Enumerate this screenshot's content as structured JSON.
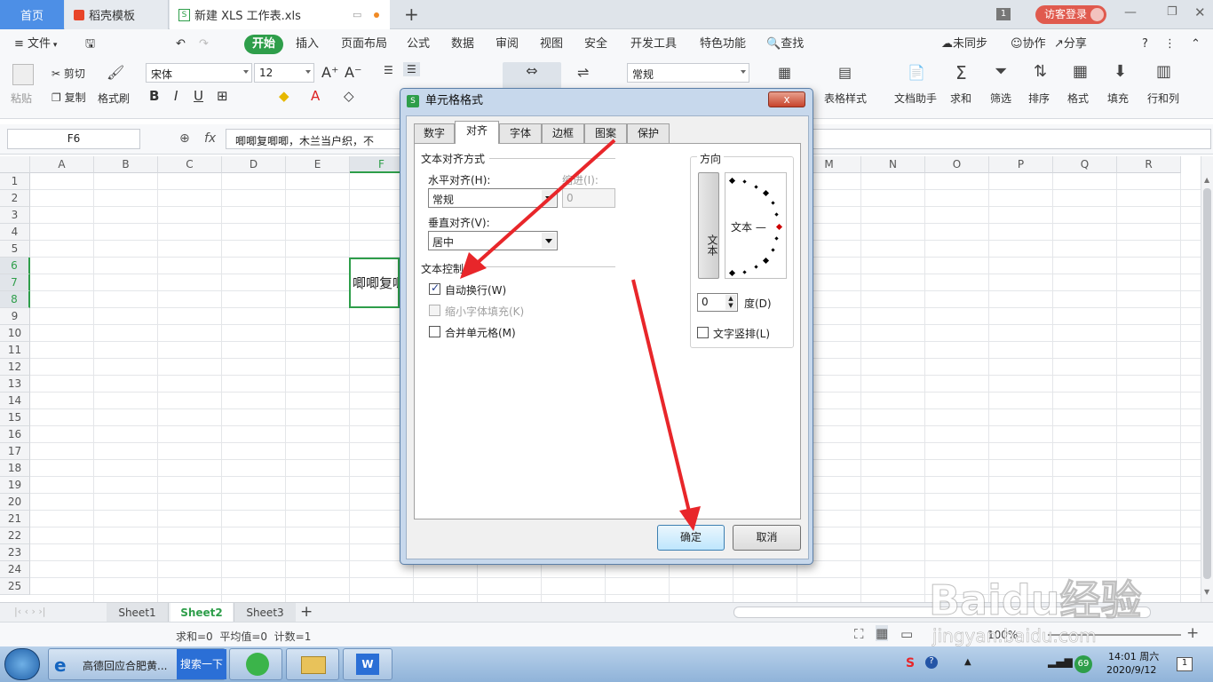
{
  "tabs": {
    "home": "首页",
    "template": "稻壳模板",
    "file": "新建 XLS 工作表.xls",
    "add": "+"
  },
  "titlebar": {
    "badge": "1",
    "login": "访客登录"
  },
  "menu": {
    "file": "文件",
    "items": [
      "开始",
      "插入",
      "页面布局",
      "公式",
      "数据",
      "审阅",
      "视图",
      "安全",
      "开发工具",
      "特色功能"
    ],
    "search": "查找",
    "sync": "未同步",
    "collab": "协作",
    "share": "分享"
  },
  "ribbon": {
    "paste": "粘贴",
    "cut": "剪切",
    "copy": "复制",
    "format_painter": "格式刷",
    "font_name": "宋体",
    "font_size": "12",
    "number_format": "常规",
    "table_style": "表格样式",
    "doc_helper": "文档助手",
    "sum": "求和",
    "filter": "筛选",
    "sort": "排序",
    "format": "格式",
    "fill": "填充",
    "rowcol": "行和列"
  },
  "formula": {
    "cell_ref": "F6",
    "fx": "fx",
    "content": "唧唧复唧唧，木兰当户织，不"
  },
  "columns": [
    "A",
    "B",
    "C",
    "D",
    "E",
    "F",
    "G",
    "H",
    "I",
    "J",
    "K",
    "L",
    "M",
    "N",
    "O",
    "P",
    "Q",
    "R"
  ],
  "rows": [
    "1",
    "2",
    "3",
    "4",
    "5",
    "6",
    "7",
    "8",
    "9",
    "10",
    "11",
    "12",
    "13",
    "14",
    "15",
    "16",
    "17",
    "18",
    "19",
    "20",
    "21",
    "22",
    "23",
    "24",
    "25"
  ],
  "cell_f6": "唧唧复唧",
  "sheets": [
    "Sheet1",
    "Sheet2",
    "Sheet3"
  ],
  "active_sheet": "Sheet2",
  "status": {
    "text": "求和=0  平均值=0  计数=1",
    "zoom": "100%"
  },
  "dialog": {
    "title": "单元格格式",
    "close": "x",
    "tabs": [
      "数字",
      "对齐",
      "字体",
      "边框",
      "图案",
      "保护"
    ],
    "active_tab": "对齐",
    "text_align_group": "文本对齐方式",
    "h_align_label": "水平对齐(H):",
    "h_align_value": "常规",
    "indent_label": "缩进(I):",
    "indent_value": "0",
    "v_align_label": "垂直对齐(V):",
    "v_align_value": "居中",
    "text_control_group": "文本控制",
    "wrap_text": "自动换行(W)",
    "wrap_checked": true,
    "shrink_fit": "缩小字体填充(K)",
    "merge_cells": "合并单元格(M)",
    "orientation_group": "方向",
    "vertical_text": "文本",
    "orient_text": "文本 —",
    "degrees_value": "0",
    "degrees_label": "度(D)",
    "vertical_stack": "文字竖排(L)",
    "ok": "确定",
    "cancel": "取消"
  },
  "taskbar": {
    "ie_title": "高德回应合肥黄...",
    "search_btn": "搜索一下",
    "time": "14:01 周六",
    "date": "2020/9/12",
    "badge": "69"
  },
  "watermark": {
    "brand": "Baidu经验",
    "url": "jingyan.baidu.com"
  },
  "colors": {
    "accent_green": "#2e9e4a",
    "tab_blue": "#4d8fe6",
    "arrow_red": "#e8262a"
  }
}
